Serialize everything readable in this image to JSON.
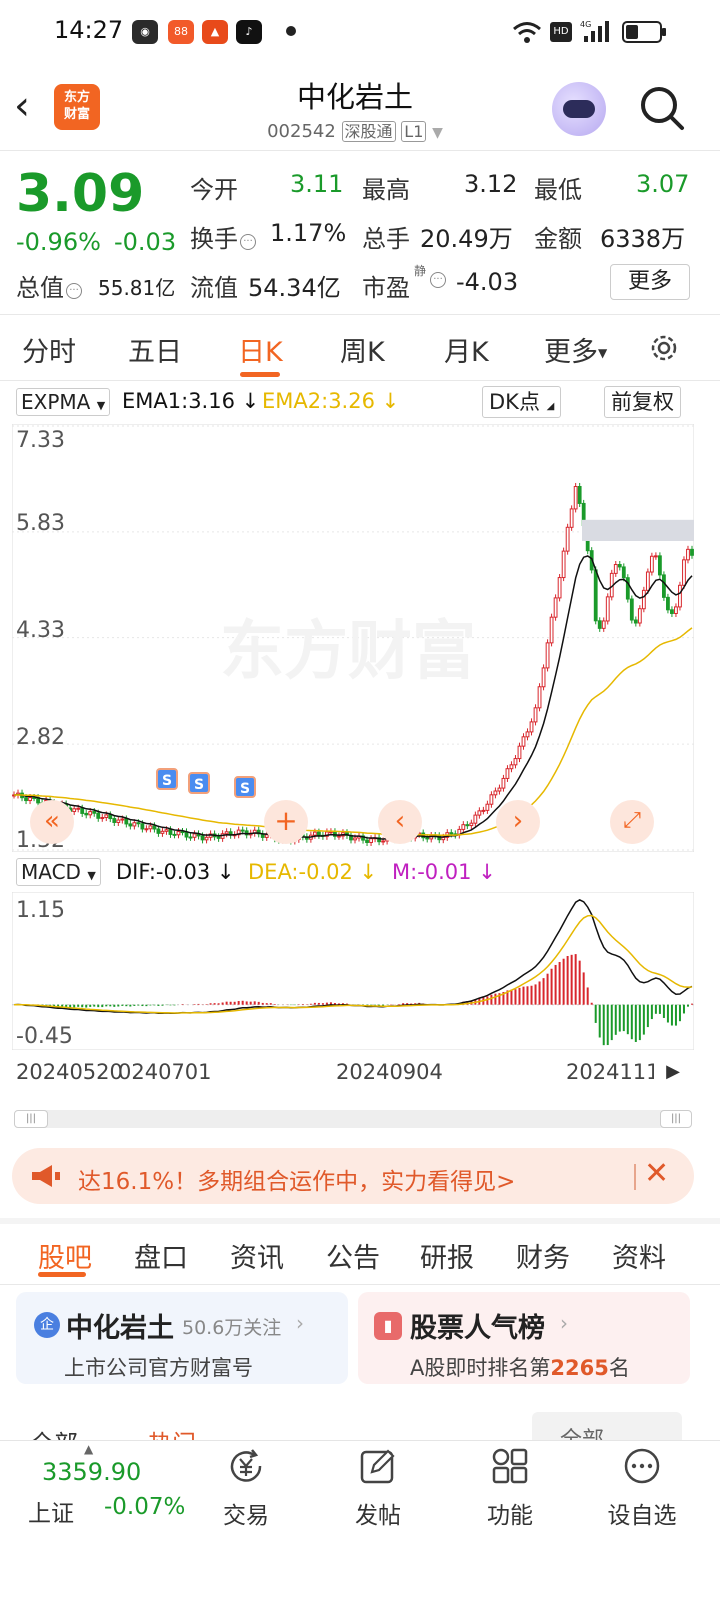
{
  "status_bar": {
    "time": "14:27",
    "icons": [
      "wechat-icon",
      "app-icon-a",
      "app-icon-b",
      "tiktok-icon",
      "wifi-icon",
      "hd-icon",
      "4g-signal-icon",
      "battery-icon"
    ]
  },
  "header": {
    "back": "‹",
    "logo": "东方\n财富",
    "logo_line1": "东方",
    "logo_line2": "财富",
    "stock_name": "中化岩土",
    "stock_code": "002542",
    "exchange_tag": "深股通",
    "level_tag": "L1"
  },
  "quote": {
    "price": "3.09",
    "change_pct": "-0.96%",
    "change": "-0.03",
    "open_label": "今开",
    "open": "3.11",
    "high_label": "最高",
    "high": "3.12",
    "low_label": "最低",
    "low": "3.07",
    "turnover_label": "换手",
    "turnover": "1.17%",
    "volume_label": "总手",
    "volume": "20.49万",
    "amount_label": "金额",
    "amount": "6338万",
    "mktcap_label": "总值",
    "mktcap": "55.81亿",
    "float_label": "流值",
    "float_cap": "54.34亿",
    "pe_label": "市盈",
    "pe_tag": "静",
    "pe": "-4.03",
    "more": "更多"
  },
  "period_tabs": [
    "分时",
    "五日",
    "日K",
    "周K",
    "月K",
    "更多"
  ],
  "period_active": "日K",
  "indicator": {
    "name": "EXPMA",
    "ema1": "EMA1:3.16",
    "ema2": "EMA2:3.26",
    "dk": "DK点",
    "adjust": "前复权"
  },
  "price_axis": [
    "7.33",
    "5.83",
    "4.33",
    "2.82",
    "1.32"
  ],
  "macd": {
    "name": "MACD",
    "dif": "DIF:-0.03",
    "dea": "DEA:-0.02",
    "m": "M:-0.01",
    "axis_top": "1.15",
    "axis_bottom": "-0.45"
  },
  "dates": [
    "20240520",
    "0240701",
    "20240904",
    "2024111"
  ],
  "watermark": "东方财富",
  "banner": {
    "text": "达16.1%！多期组合运作中，实力看得见>"
  },
  "content_tabs": [
    "股吧",
    "盘口",
    "资讯",
    "公告",
    "研报",
    "财务",
    "资料"
  ],
  "content_active": "股吧",
  "cards": {
    "company": {
      "badge": "企",
      "name": "中化岩土",
      "followers": "50.6万关注",
      "sub": "上市公司官方财富号"
    },
    "popularity": {
      "title": "股票人气榜",
      "sub_prefix": "A股即时排名第",
      "rank": "2265",
      "sub_suffix": "名"
    }
  },
  "partial_row": {
    "left1": "全部",
    "left2": "热门",
    "right": "全部"
  },
  "bottom_nav": {
    "index_value": "3359.90",
    "index_name": "上证",
    "index_change": "-0.07%",
    "items": [
      "交易",
      "发帖",
      "功能",
      "设自选"
    ]
  },
  "colors": {
    "up": "#d8262c",
    "down": "#1a9a2a",
    "accent": "#f26522",
    "ema1": "#111111",
    "ema2": "#e6b800",
    "macd_m": "#c020c0"
  },
  "chart_data": {
    "type": "candlestick",
    "price_ylim": [
      1.32,
      7.33
    ],
    "price_ticks": [
      7.33,
      5.83,
      4.33,
      2.82,
      1.32
    ],
    "price_series": [
      {
        "x": "20240520",
        "close": 2.1
      },
      {
        "x": "20240701",
        "close": 1.55
      },
      {
        "x": "20240904",
        "close": 1.45
      },
      {
        "x": "2024111",
        "close": 5.2
      },
      {
        "x": "latest",
        "close": 3.09
      }
    ],
    "macd_ylim": [
      -0.45,
      1.15
    ]
  }
}
